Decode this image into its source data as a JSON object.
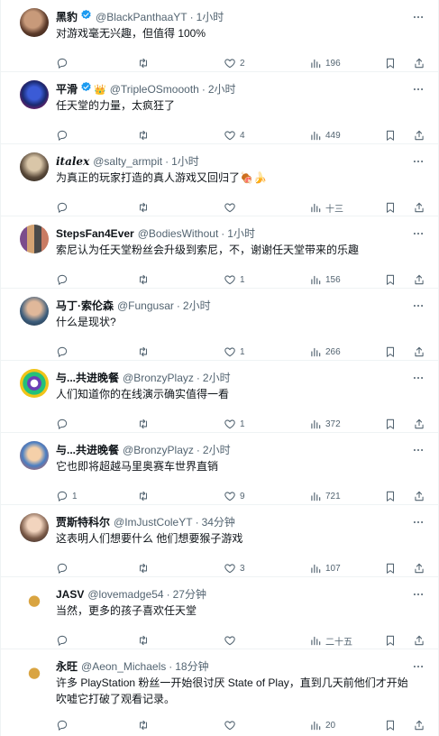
{
  "tweets": [
    {
      "name": "黑豹",
      "verified": true,
      "handle": "@BlackPanthaaYT",
      "time": "1小时",
      "text": "对游戏毫无兴趣，但值得 100%",
      "replies": "",
      "likes": "2",
      "views": "196"
    },
    {
      "name": "平滑",
      "verified": true,
      "crown": "👑",
      "handle": "@TripleOSmoooth",
      "time": "2小时",
      "text": "任天堂的力量，太疯狂了",
      "replies": "",
      "likes": "4",
      "views": "449"
    },
    {
      "name": "italex",
      "italic": true,
      "handle": "@salty_armpit",
      "time": "1小时",
      "text": "为真正的玩家打造的真人游戏又回归了",
      "emoji": "🍖🍌",
      "replies": "",
      "likes": "",
      "views": "十三"
    },
    {
      "name": "StepsFan4Ever",
      "handle": "@BodiesWithout",
      "time": "1小时",
      "text": "索尼认为任天堂粉丝会升级到索尼，不，谢谢任天堂带来的乐趣",
      "replies": "",
      "likes": "1",
      "views": "156"
    },
    {
      "name": "马丁·索伦森",
      "handle": "@Fungusar",
      "time": "2小时",
      "text": "什么是现状?",
      "replies": "",
      "likes": "1",
      "views": "266"
    },
    {
      "name": "与...共进晚餐",
      "handle": "@BronzyPlayz",
      "time": "2小时",
      "text": "人们知道你的在线演示确实值得一看",
      "replies": "",
      "likes": "1",
      "views": "372"
    },
    {
      "name": "与...共进晚餐",
      "handle": "@BronzyPlayz",
      "time": "2小时",
      "text": "它也即将超越马里奥赛车世界直销",
      "replies": "1",
      "likes": "9",
      "views": "721"
    },
    {
      "name": "贾斯特科尔",
      "handle": "@ImJustColeYT",
      "time": "34分钟",
      "text": "这表明人们想要什么 他们想要猴子游戏",
      "replies": "",
      "likes": "3",
      "views": "107"
    },
    {
      "name": "JASV",
      "handle": "@lovemadge54",
      "time": "27分钟",
      "text": "当然，更多的孩子喜欢任天堂",
      "replies": "",
      "likes": "",
      "views": "二十五"
    },
    {
      "name": "永旺",
      "handle": "@Aeon_Michaels",
      "time": "18分钟",
      "text": "许多 PlayStation 粉丝一开始很讨厌 State of Play，直到几天前他们才开始吹嘘它打破了观看记录。",
      "replies": "",
      "likes": "",
      "views": "20"
    }
  ],
  "icons": {
    "verified": "verified-badge-icon",
    "more": "more-horizontal-icon",
    "reply": "reply-icon",
    "retweet": "retweet-icon",
    "like": "heart-icon",
    "views": "views-chart-icon",
    "bookmark": "bookmark-icon",
    "share": "share-icon"
  },
  "colors": {
    "verified": "#1d9bf0",
    "muted": "#536471",
    "text": "#0f1419",
    "border": "#eff3f4"
  }
}
